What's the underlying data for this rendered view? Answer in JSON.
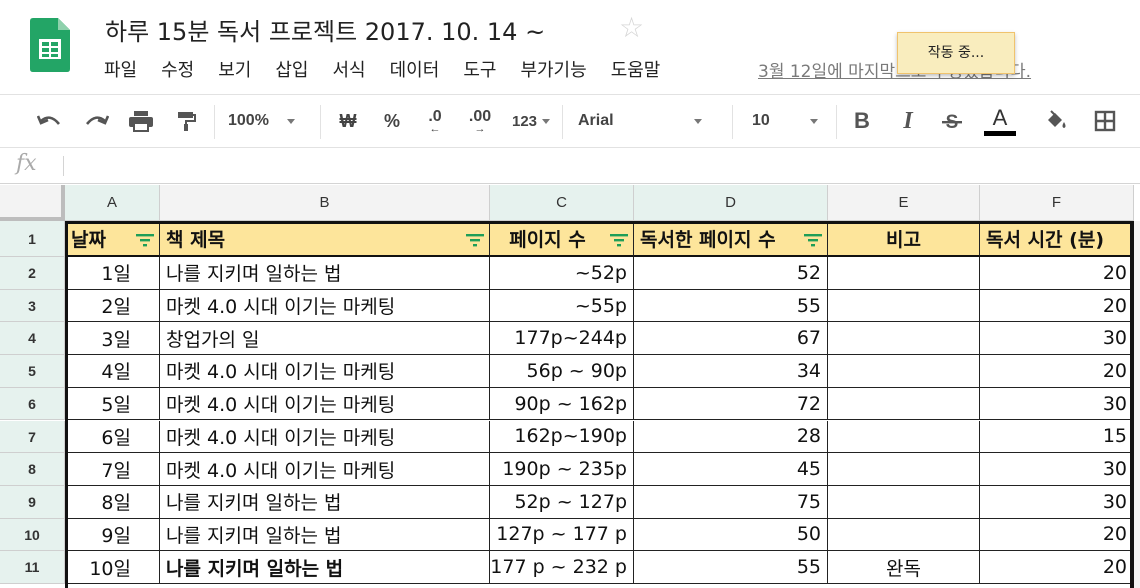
{
  "doc": {
    "title": "하루 15분 독서 프로젝트 2017. 10. 14 ~",
    "last_edit": "3월 12일에 마지막으로 수정했습니다.",
    "working_toast": "작동 중..."
  },
  "menu": [
    "파일",
    "수정",
    "보기",
    "삽입",
    "서식",
    "데이터",
    "도구",
    "부가기능",
    "도움말"
  ],
  "toolbar": {
    "zoom": "100%",
    "currency": "₩",
    "percent": "%",
    "decrease_decimal": ".0",
    "increase_decimal": ".00",
    "more_formats": "123",
    "font": "Arial",
    "font_size": "10",
    "bold": "B",
    "italic": "I",
    "text_color": "A",
    "text_color_swatch": "#000000",
    "icons": [
      "undo-icon",
      "redo-icon",
      "print-icon",
      "paint-format-icon",
      "strikethrough-icon",
      "fill-color-icon",
      "borders-icon",
      "star-icon",
      "sheets-logo-icon",
      "filter-icon"
    ]
  },
  "formula_bar": {
    "label": "fx",
    "value": ""
  },
  "grid": {
    "columns": [
      "A",
      "B",
      "C",
      "D",
      "E",
      "F"
    ],
    "row_numbers": [
      "1",
      "2",
      "3",
      "4",
      "5",
      "6",
      "7",
      "8",
      "9",
      "10",
      "11"
    ],
    "header": [
      "날짜",
      "책 제목",
      "페이지 수",
      "독서한 페이지 수",
      "비고",
      "독서 시간 (분)"
    ],
    "rows": [
      [
        "1일",
        "나를 지키며 일하는 법",
        "~52p",
        "52",
        "",
        "20"
      ],
      [
        "2일",
        "마켓 4.0 시대 이기는 마케팅",
        "~55p",
        "55",
        "",
        "20"
      ],
      [
        "3일",
        "창업가의 일",
        "177p~244p",
        "67",
        "",
        "30"
      ],
      [
        "4일",
        "마켓 4.0 시대 이기는 마케팅",
        "56p ~ 90p",
        "34",
        "",
        "20"
      ],
      [
        "5일",
        "마켓 4.0 시대 이기는 마케팅",
        "90p ~ 162p",
        "72",
        "",
        "30"
      ],
      [
        "6일",
        "마켓 4.0 시대 이기는 마케팅",
        "162p~190p",
        "28",
        "",
        "15"
      ],
      [
        "7일",
        "마켓 4.0 시대 이기는 마케팅",
        "190p ~ 235p",
        "45",
        "",
        "30"
      ],
      [
        "8일",
        "나를 지키며 일하는 법",
        "52p ~ 127p",
        "75",
        "",
        "30"
      ],
      [
        "9일",
        "나를 지키며 일하는 법",
        "127p ~ 177 p",
        "50",
        "",
        "20"
      ],
      [
        "10일",
        "나를 지키며 일하는 법",
        "177 p ~ 232 p",
        "55",
        "완독",
        "20"
      ]
    ],
    "bold_rows": [
      10
    ],
    "colors": {
      "header_fill": "#fde59b",
      "selected_header": "#e6f2ee",
      "filter_icon": "#1e9e57",
      "logo_green": "#23a566"
    }
  }
}
